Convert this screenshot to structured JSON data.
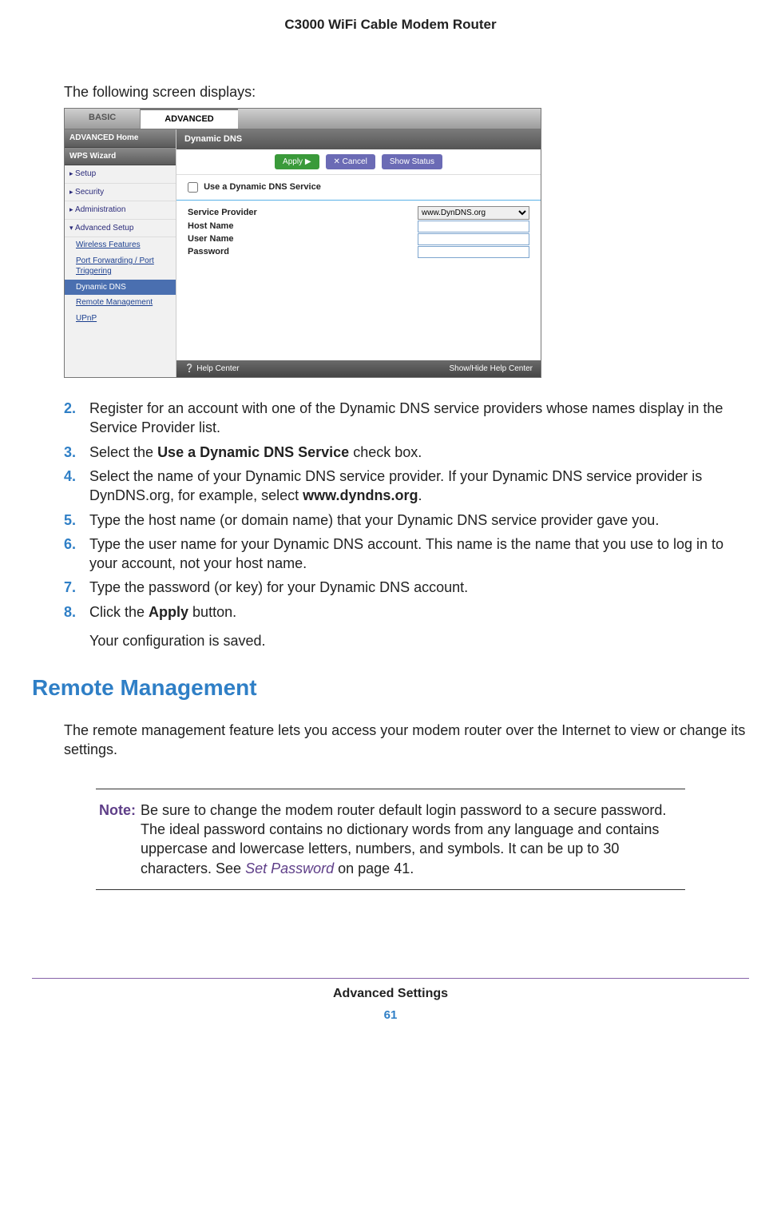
{
  "header": "C3000 WiFi Cable Modem Router",
  "intro": "The following screen displays:",
  "shot": {
    "tabs": {
      "basic": "BASIC",
      "advanced": "ADVANCED"
    },
    "side": {
      "home": "ADVANCED Home",
      "wps": "WPS Wizard",
      "setup": "Setup",
      "security": "Security",
      "admin": "Administration",
      "advsetup": "Advanced Setup",
      "subs": {
        "wireless": "Wireless Features",
        "portfwd": "Port Forwarding / Port Triggering",
        "ddns": "Dynamic DNS",
        "remote": "Remote Management",
        "upnp": "UPnP"
      }
    },
    "panel": {
      "title": "Dynamic DNS",
      "apply": "Apply ▶",
      "cancel": "✕ Cancel",
      "status": "Show Status",
      "checkbox": "Use a Dynamic DNS Service",
      "rows": {
        "provider": "Service Provider",
        "provider_value": "www.DynDNS.org",
        "host": "Host Name",
        "user": "User Name",
        "pass": "Password"
      }
    },
    "footer": {
      "help": "❔ Help Center",
      "showhide": "Show/Hide Help Center"
    }
  },
  "steps": [
    {
      "n": "2.",
      "html": "Register for an account with one of the Dynamic DNS service providers whose names display in the Service Provider list."
    },
    {
      "n": "3.",
      "html": "Select the <b>Use a Dynamic DNS Service</b> check box."
    },
    {
      "n": "4.",
      "html": "Select the name of your Dynamic DNS service provider. If your Dynamic DNS service provider is DynDNS.org, for example, select <b>www.dyndns.org</b>."
    },
    {
      "n": "5.",
      "html": "Type the host name (or domain name) that your Dynamic DNS service provider gave you."
    },
    {
      "n": "6.",
      "html": "Type the user name for your Dynamic DNS account. This name is the name that you use to log in to your account, not your host name."
    },
    {
      "n": "7.",
      "html": "Type the password (or key) for your Dynamic DNS account."
    },
    {
      "n": "8.",
      "html": "Click the <b>Apply</b> button."
    }
  ],
  "after_steps": "Your configuration is saved.",
  "section_heading": "Remote Management",
  "section_para": "The remote management feature lets you access your modem router over the Internet to view or change its settings.",
  "note": {
    "label": "Note:",
    "body_pre": "Be sure to change the modem router default login password to a secure password. The ideal password contains no dictionary words from any language and contains uppercase and lowercase letters, numbers, and symbols. It can be up to 30 characters. See ",
    "link": "Set Password",
    "body_post": " on page 41."
  },
  "footer": {
    "title": "Advanced Settings",
    "page": "61"
  }
}
